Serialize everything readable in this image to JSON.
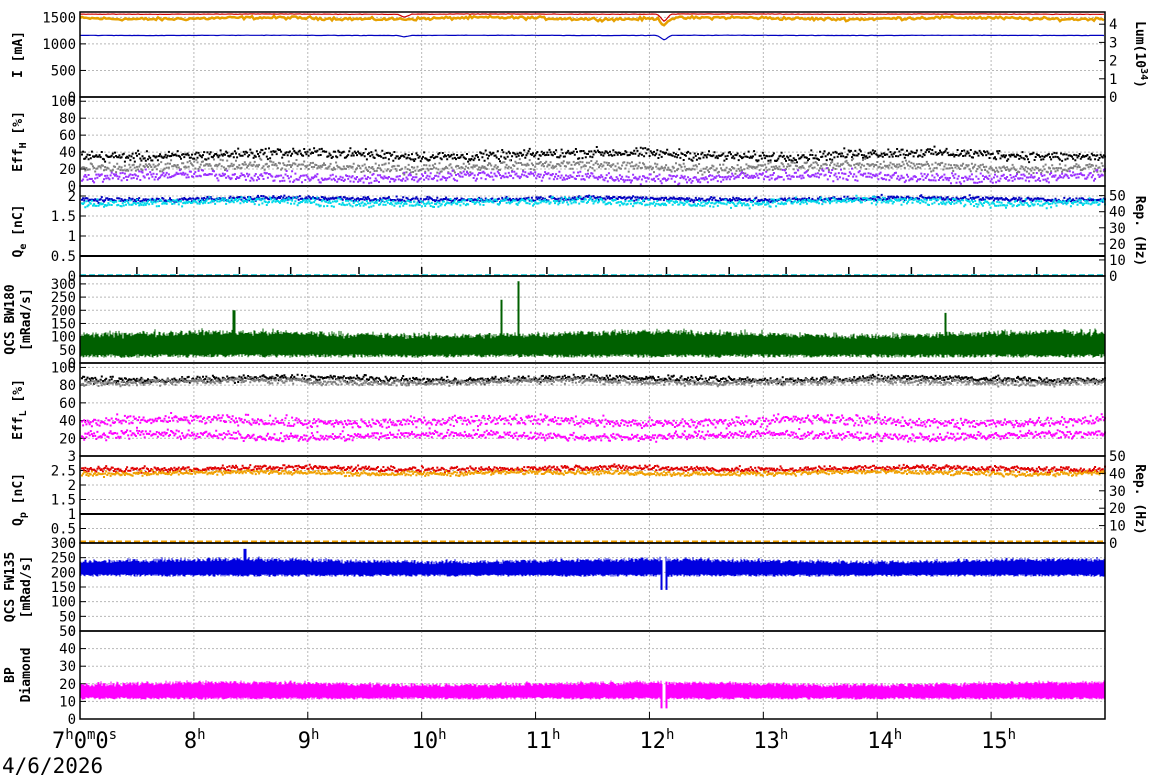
{
  "date": "4/6/2026",
  "time_axis": {
    "range_h": [
      7,
      16
    ],
    "ticks": [
      {
        "h": 7,
        "label": "7",
        "sup1": "h",
        "mid1": "0",
        "sup2": "m",
        "mid2": "0",
        "sup3": "s"
      },
      {
        "h": 8,
        "label": "8",
        "sup1": "h"
      },
      {
        "h": 9,
        "label": "9",
        "sup1": "h"
      },
      {
        "h": 10,
        "label": "10",
        "sup1": "h"
      },
      {
        "h": 11,
        "label": "11",
        "sup1": "h"
      },
      {
        "h": 12,
        "label": "12",
        "sup1": "h"
      },
      {
        "h": 13,
        "label": "13",
        "sup1": "h"
      },
      {
        "h": 14,
        "label": "14",
        "sup1": "h"
      },
      {
        "h": 15,
        "label": "15",
        "sup1": "h"
      }
    ]
  },
  "chart_data": [
    {
      "type": "line",
      "ylabel": "I [mA]",
      "ylim": [
        0,
        1600
      ],
      "yticks": [
        0,
        500,
        1000,
        1500
      ],
      "y2label_main": "Lum(10",
      "y2label_sup": "34",
      "y2label_end": ")",
      "y2lim": [
        0,
        4.67
      ],
      "y2ticks": [
        0,
        1,
        2,
        3,
        4
      ],
      "grid": true,
      "series": [
        {
          "color": "#e6a000",
          "axis": "y",
          "kind": "line",
          "baseline": 1480,
          "noise": 25,
          "dips": [
            {
              "h": 12.13,
              "depth": 120
            }
          ]
        },
        {
          "color": "#d00000",
          "axis": "y",
          "kind": "line",
          "baseline": 1560,
          "noise": 4,
          "dips": [
            {
              "h": 9.85,
              "depth": 60
            },
            {
              "h": 12.13,
              "depth": 140
            }
          ]
        },
        {
          "color": "#0000c0",
          "axis": "y",
          "kind": "line",
          "baseline": 1160,
          "noise": 3,
          "dips": [
            {
              "h": 9.85,
              "depth": 30
            },
            {
              "h": 12.13,
              "depth": 90
            }
          ]
        }
      ]
    },
    {
      "type": "scatter",
      "ylabel": "Eff",
      "ylabel_sub": "H",
      "ylabel_end": " [%]",
      "ylim": [
        0,
        105
      ],
      "yticks": [
        0,
        20,
        40,
        60,
        80,
        100
      ],
      "grid": true,
      "series": [
        {
          "color": "#000000",
          "kind": "dots",
          "baseline": 38,
          "noise": 5
        },
        {
          "color": "#808080",
          "kind": "dots",
          "baseline": 24,
          "noise": 5
        },
        {
          "color": "#9b30ff",
          "kind": "dots",
          "baseline": 12,
          "noise": 5
        }
      ]
    },
    {
      "type": "scatter",
      "ylabel": "Q",
      "ylabel_sub": "e",
      "ylabel_end": " [nC]",
      "ylim": [
        0,
        2.25
      ],
      "yticks": [
        0,
        0.5,
        1,
        1.5,
        2
      ],
      "y2label": "Rep. (Hz)",
      "y2lim": [
        0,
        56
      ],
      "y2ticks": [
        0,
        10,
        20,
        30,
        40,
        50
      ],
      "grid": true,
      "series": [
        {
          "color": "#0000c0",
          "kind": "dots",
          "baseline": 1.95,
          "noise": 0.05
        },
        {
          "color": "#00d8e8",
          "kind": "dots",
          "baseline": 1.87,
          "noise": 0.08
        },
        {
          "color": "#000000",
          "kind": "step",
          "baseline": 0.5,
          "noise": 0,
          "spikes": [
            7.5,
            7.85,
            8.4,
            8.85,
            9.45,
            10.0,
            10.6,
            11.1,
            11.6,
            12.15,
            12.7,
            13.2,
            13.75,
            14.3,
            14.85,
            15.4
          ]
        },
        {
          "color": "#00c8d8",
          "kind": "flat",
          "baseline": 0.02,
          "noise": 0
        }
      ]
    },
    {
      "type": "area",
      "ylabel": "QCS BW180",
      "ylabel2": "[mRad/s]",
      "ylim": [
        0,
        330
      ],
      "yticks": [
        0,
        50,
        100,
        150,
        200,
        250,
        300
      ],
      "grid": true,
      "series": [
        {
          "color": "#006000",
          "kind": "band",
          "low": 20,
          "high": 110,
          "peaks": [
            {
              "h": 8.35,
              "v": 200
            },
            {
              "h": 10.85,
              "v": 310
            },
            {
              "h": 10.7,
              "v": 240
            },
            {
              "h": 14.6,
              "v": 190
            }
          ]
        }
      ]
    },
    {
      "type": "scatter",
      "ylabel": "Eff",
      "ylabel_sub": "L",
      "ylabel_end": " [%]",
      "ylim": [
        0,
        105
      ],
      "yticks": [
        20,
        40,
        60,
        80,
        100
      ],
      "grid": true,
      "series": [
        {
          "color": "#000000",
          "kind": "dots",
          "baseline": 88,
          "noise": 3
        },
        {
          "color": "#808080",
          "kind": "dots",
          "baseline": 85,
          "noise": 3
        },
        {
          "color": "#ff00ff",
          "kind": "dots",
          "baseline": 40,
          "noise": 5
        },
        {
          "color": "#ff00ff",
          "kind": "dots",
          "baseline": 24,
          "noise": 4
        }
      ]
    },
    {
      "type": "scatter",
      "ylabel": "Q",
      "ylabel_sub": "p",
      "ylabel_end": " [nC]",
      "ylim": [
        0,
        3.0
      ],
      "yticks": [
        0,
        0.5,
        1,
        1.5,
        2,
        2.5,
        3
      ],
      "y2label": "Rep. (Hz)",
      "y2lim": [
        0,
        50
      ],
      "y2ticks": [
        0,
        10,
        20,
        30,
        40,
        50
      ],
      "grid": true,
      "series": [
        {
          "color": "#e00000",
          "kind": "dots",
          "baseline": 2.6,
          "noise": 0.08
        },
        {
          "color": "#f0a000",
          "kind": "dots",
          "baseline": 2.45,
          "noise": 0.07
        },
        {
          "color": "#000000",
          "kind": "step",
          "baseline": 1.0,
          "noise": 0,
          "spikes": []
        },
        {
          "color": "#f0a000",
          "kind": "flat",
          "baseline": 0.05,
          "noise": 0
        }
      ]
    },
    {
      "type": "area",
      "ylabel": "QCS FW135",
      "ylabel2": "[mRad/s]",
      "ylim": [
        0,
        300
      ],
      "yticks": [
        0,
        50,
        100,
        150,
        200,
        250,
        300
      ],
      "grid": true,
      "series": [
        {
          "color": "#0000e0",
          "kind": "band",
          "low": 185,
          "high": 240,
          "peaks": [
            {
              "h": 8.45,
              "v": 280
            },
            {
              "h": 12.13,
              "v": 140
            }
          ]
        }
      ]
    },
    {
      "type": "area",
      "ylabel": "BP",
      "ylabel2": "Diamond",
      "ylim": [
        0,
        50
      ],
      "yticks": [
        0,
        10,
        20,
        30,
        40,
        50
      ],
      "grid": true,
      "series": [
        {
          "color": "#ff00ff",
          "kind": "band",
          "low": 11,
          "high": 20,
          "peaks": [
            {
              "h": 12.13,
              "v": 6
            }
          ]
        }
      ]
    }
  ]
}
